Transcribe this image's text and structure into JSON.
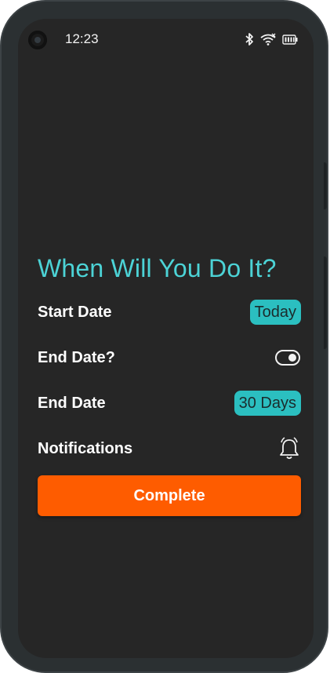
{
  "status_bar": {
    "time": "12:23"
  },
  "screen": {
    "title": "When Will You Do It?",
    "rows": [
      {
        "label": "Start Date",
        "value": "Today"
      },
      {
        "label": "End Date?",
        "toggle": "off"
      },
      {
        "label": "End Date",
        "value": "30 Days"
      },
      {
        "label": "Notifications",
        "icon": "bell-icon"
      }
    ],
    "complete_label": "Complete"
  },
  "colors": {
    "accent": "#4cd3d6",
    "pill": "#2bbfc0",
    "button": "#fe5c00",
    "background": "#262626"
  }
}
